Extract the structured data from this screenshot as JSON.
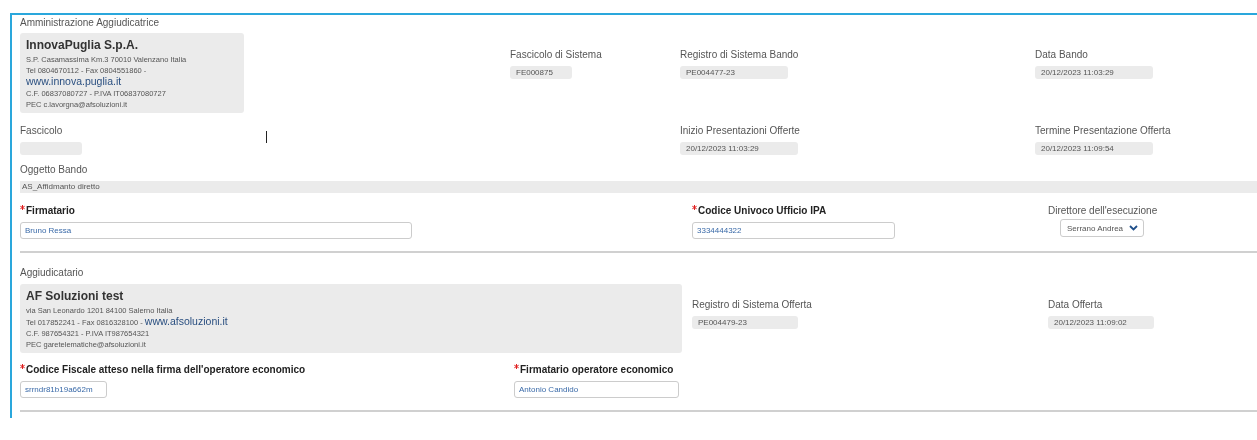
{
  "amministrazione": {
    "heading": "Amministrazione Aggiudicatrice",
    "card": {
      "name": "InnovaPuglia S.p.A.",
      "address": "S.P. Casamassima Km.3 70010 Valenzano Italia",
      "contact": "Tel 0804670112 - Fax 0804551860 -",
      "website": "www.innova.puglia.it",
      "fiscal": "C.F. 06837080727 - P.IVA IT06837080727",
      "pec": "PEC c.lavorgna@afsoluzioni.it"
    },
    "fields": [
      {
        "label": "Fascicolo di Sistema",
        "value": "FE000875",
        "kind": "readonly",
        "required": false
      },
      {
        "label": "Registro di Sistema Bando",
        "value": "PE004477-23",
        "kind": "readonly",
        "required": false
      },
      {
        "label": "Data Bando",
        "value": "20/12/2023 11:03:29",
        "kind": "readonly",
        "required": false
      }
    ]
  },
  "row_dates": [
    {
      "label": "Fascicolo",
      "kind": "readonly",
      "required": false
    },
    {
      "label": "Inizio Presentazioni Offerte",
      "value": "20/12/2023 11:03:29",
      "kind": "readonly",
      "required": false
    },
    {
      "label": "Termine Presentazione Offerta",
      "value": "20/12/2023 11:09:54",
      "kind": "readonly",
      "required": false
    }
  ],
  "oggetto": {
    "label": "Oggetto Bando",
    "value": "AS_Affidmanto diretto"
  },
  "row_firma": [
    {
      "label": "Firmatario",
      "value": "Bruno Ressa",
      "kind": "input",
      "required": true
    },
    {
      "label": "Codice Univoco Ufficio IPA",
      "value": "3334444322",
      "kind": "input",
      "required": true
    },
    {
      "label": "Direttore dell'esecuzione",
      "value": "Serrano Andrea",
      "kind": "select",
      "required": false
    }
  ],
  "aggiudicatario": {
    "heading": "Aggiudicatario",
    "card": {
      "name": "AF Soluzioni test",
      "address": "via San Leonardo 1201 84100 Salerno Italia",
      "contact": "Tel 017852241 - Fax 0816328100 -",
      "website": "www.afsoluzioni.it",
      "fiscal": "C.F. 987654321 - P.IVA IT987654321",
      "pec": "PEC garetelematiche@afsoluzioni.it"
    },
    "fields": [
      {
        "label": "Registro di Sistema Offerta",
        "value": "PE004479-23",
        "kind": "readonly",
        "required": false
      },
      {
        "label": "Data Offerta",
        "value": "20/12/2023 11:09:02",
        "kind": "readonly",
        "required": false
      }
    ]
  },
  "row_operatore": [
    {
      "label": "Codice Fiscale atteso nella firma dell'operatore economico",
      "value": "srrndr81b19a662m",
      "kind": "input",
      "required": true
    },
    {
      "label": "Firmatario operatore economico",
      "value": "Antonio Candido",
      "kind": "input",
      "required": true
    }
  ]
}
